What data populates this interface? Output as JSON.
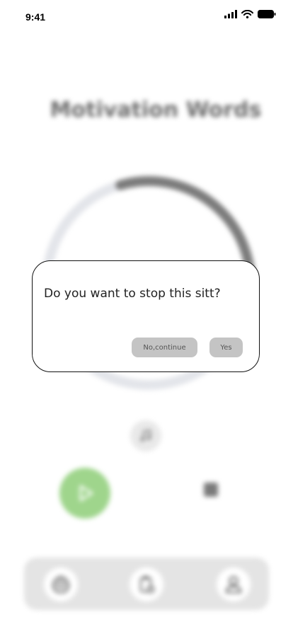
{
  "status_bar": {
    "time": "9:41"
  },
  "background": {
    "title": "Motivation Words",
    "timer_progress": 0.34,
    "colors": {
      "ring_track": "#e3e5ea",
      "ring_progress": "#7b7b7b",
      "play": "#9fd58c"
    }
  },
  "dialog": {
    "question": "Do you want to stop this sitt?",
    "no_label": "No,continue",
    "yes_label": "Yes"
  },
  "icons": {
    "music": "music-note-icon",
    "play": "play-icon",
    "stop": "stop-icon",
    "settings": "gear-icon",
    "history": "clipboard-clock-icon",
    "profile": "user-icon"
  }
}
